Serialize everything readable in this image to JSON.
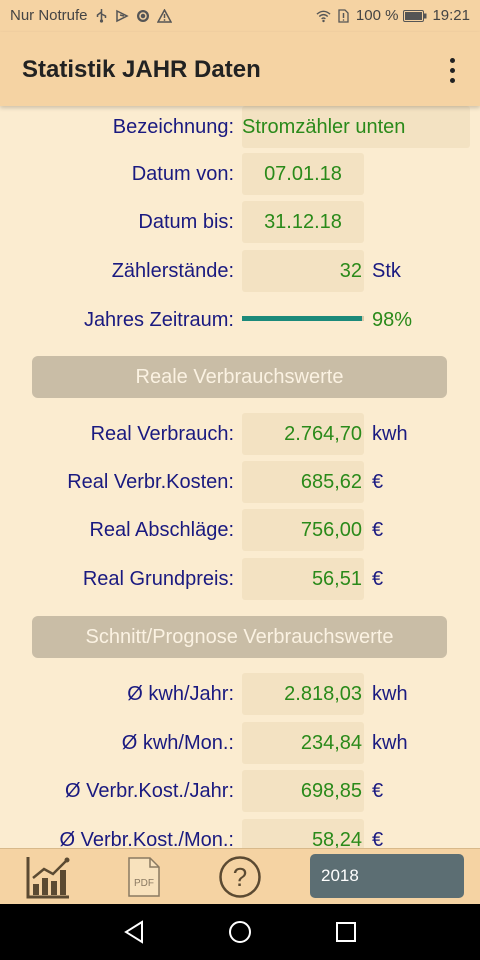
{
  "status_bar": {
    "carrier": "Nur Notrufe",
    "battery": "100 %",
    "time": "19:21",
    "icons_left": [
      "usb-icon",
      "debug-icon",
      "sync-icon",
      "warning-icon"
    ],
    "icons_right": [
      "wifi-icon",
      "sim-icon",
      "battery-icon"
    ]
  },
  "app_bar": {
    "title": "Statistik JAHR Daten",
    "menu_icon": "more-vert-icon"
  },
  "info": {
    "bezeichnung": {
      "label": "Bezeichnung:",
      "value": "Stromzähler unten"
    },
    "datum_von": {
      "label": "Datum von:",
      "value": "07.01.18"
    },
    "datum_bis": {
      "label": "Datum bis:",
      "value": "31.12.18"
    },
    "zaehlerstaende": {
      "label": "Zählerstände:",
      "value": "32",
      "unit": "Stk"
    },
    "jahres_zeitraum": {
      "label": "Jahres Zeitraum:",
      "percent_text": "98%",
      "fraction": 0.98
    }
  },
  "real": {
    "header": "Reale Verbrauchswerte",
    "rows": [
      {
        "label": "Real Verbrauch:",
        "value": "2.764,70",
        "unit": "kwh"
      },
      {
        "label": "Real Verbr.Kosten:",
        "value": "685,62",
        "unit": "€"
      },
      {
        "label": "Real Abschläge:",
        "value": "756,00",
        "unit": "€"
      },
      {
        "label": "Real Grundpreis:",
        "value": "56,51",
        "unit": "€"
      }
    ]
  },
  "prognose": {
    "header": "Schnitt/Prognose Verbrauchswerte",
    "rows": [
      {
        "label": "Ø kwh/Jahr:",
        "value": "2.818,03",
        "unit": "kwh"
      },
      {
        "label": "Ø kwh/Mon.:",
        "value": "234,84",
        "unit": "kwh"
      },
      {
        "label": "Ø Verbr.Kost./Jahr:",
        "value": "698,85",
        "unit": "€"
      },
      {
        "label": "Ø Verbr.Kost./Mon.:",
        "value": "58,24",
        "unit": "€"
      }
    ]
  },
  "bottom_bar": {
    "icons": [
      "chart-icon",
      "pdf-icon",
      "help-icon"
    ],
    "pdf_label": "PDF",
    "help_label": "?",
    "year": "2018"
  },
  "colors": {
    "app_bar": "#f5d3a3",
    "background": "#fbecd0",
    "label_text": "#1a1a80",
    "value_text": "#2a8a1a",
    "section_bg": "#c9bda6",
    "progress": "#1b8a7a",
    "year_button": "#5c6e73"
  }
}
